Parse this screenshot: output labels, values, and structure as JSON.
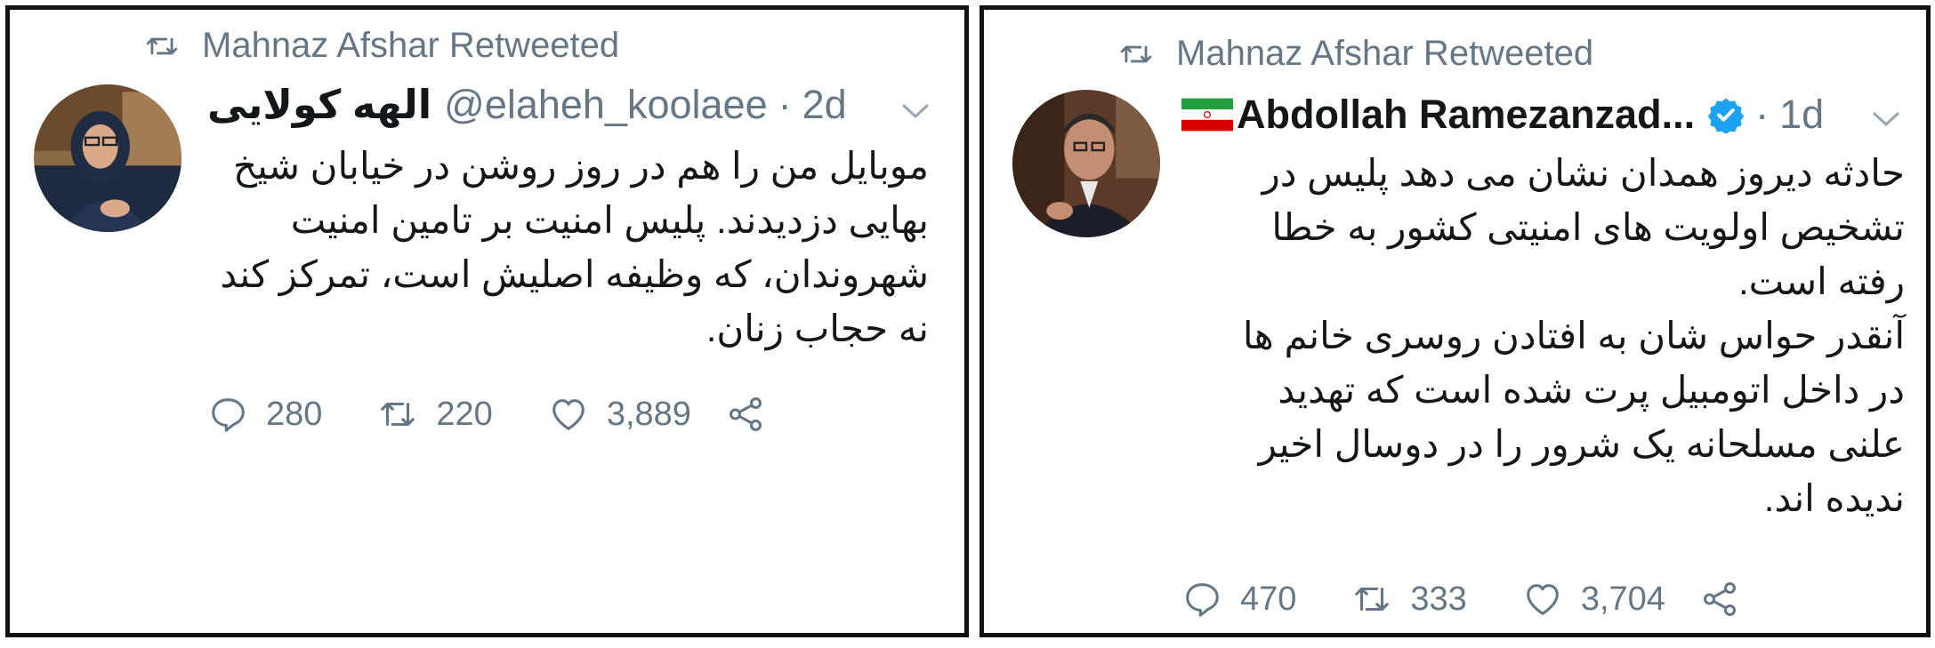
{
  "tweets": [
    {
      "retweeted_by": "Mahnaz Afshar Retweeted",
      "display_name": "الهه کولایی",
      "handle": "@elaheh_koolaee",
      "time": "2d",
      "text_lines": [
        "موبایل من را هم در روز روشن در خیابان شیخ",
        "بهایی دزدیدند. پلیس امنیت بر تامین امنیت",
        "شهروندان، که وظیفه اصلیش است، تمرکز کند",
        "نه حجاب زنان."
      ],
      "replies": "280",
      "retweets": "220",
      "likes": "3,889"
    },
    {
      "retweeted_by": "Mahnaz Afshar Retweeted",
      "display_name": "Abdollah Ramezanzad...",
      "time": "1d",
      "verified": true,
      "flag": "iran-flag",
      "text_lines": [
        "حادثه دیروز همدان نشان می دهد پلیس در",
        "تشخیص اولویت های امنیتی کشور به خطا",
        "رفته است.",
        "آنقدر حواس شان به افتادن روسری خانم ها",
        "در داخل اتومبیل پرت شده است که تهدید",
        "علنی مسلحانه یک شرور را در دوسال اخیر",
        "ندیده اند."
      ],
      "replies": "470",
      "retweets": "333",
      "likes": "3,704"
    }
  ],
  "icons": {
    "retweet": "retweet-icon",
    "reply": "reply-icon",
    "like": "heart-icon",
    "share": "share-icon",
    "menu": "chevron-down-icon",
    "verified": "verified-badge-icon"
  },
  "colors": {
    "gray": "#657786",
    "verified": "#1da1f2",
    "border": "#111111"
  },
  "separator": "·"
}
